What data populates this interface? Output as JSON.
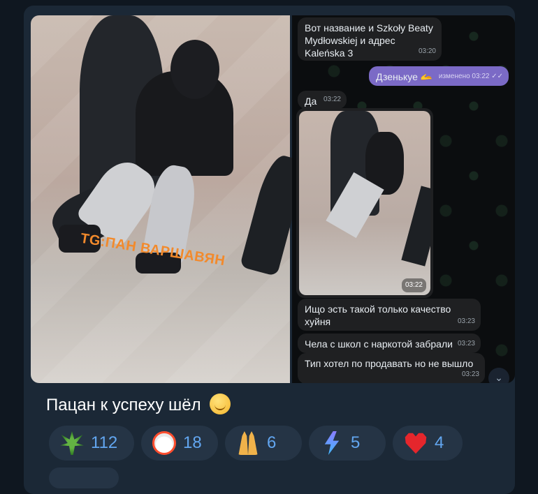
{
  "post": {
    "caption": "Пацан к успеху шёл",
    "photo_watermark": "TG:ПАН ВАРШАВЯН"
  },
  "chat_screenshot": {
    "messages": [
      {
        "text": "Вот название и Szkoły Beaty Mydłowskiej  и   адрес Kaleńska 3",
        "time": "03:20",
        "direction": "in"
      },
      {
        "text": "Дзенькуе 🫴",
        "time": "изменено 03:22 ✓✓",
        "direction": "out"
      },
      {
        "text": "Да",
        "time": "03:22",
        "direction": "in"
      },
      {
        "text": "",
        "time": "03:22",
        "direction": "in",
        "type": "photo"
      },
      {
        "text": "Ищо эсть такой только качество хуйня",
        "time": "03:23",
        "direction": "in"
      },
      {
        "text": "Чела с школ с наркотой забрали",
        "time": "03:23",
        "direction": "in"
      },
      {
        "text": "Тип хотел по продавать но не вышло",
        "time": "03:23",
        "direction": "in"
      }
    ],
    "scroll_icon": "chevron-down-icon"
  },
  "reactions": [
    {
      "icon": "cannabis-leaf-icon",
      "count": "112"
    },
    {
      "icon": "clown-face-icon",
      "count": "18"
    },
    {
      "icon": "raised-hands-icon",
      "count": "6"
    },
    {
      "icon": "lightning-icon",
      "count": "5"
    },
    {
      "icon": "heart-icon",
      "count": "4"
    }
  ],
  "colors": {
    "background": "#0f1720",
    "card": "#1b2836",
    "reaction_bg": "#253445",
    "reaction_text": "#62a6f0",
    "outgoing_bubble": "#7b6ac6"
  }
}
